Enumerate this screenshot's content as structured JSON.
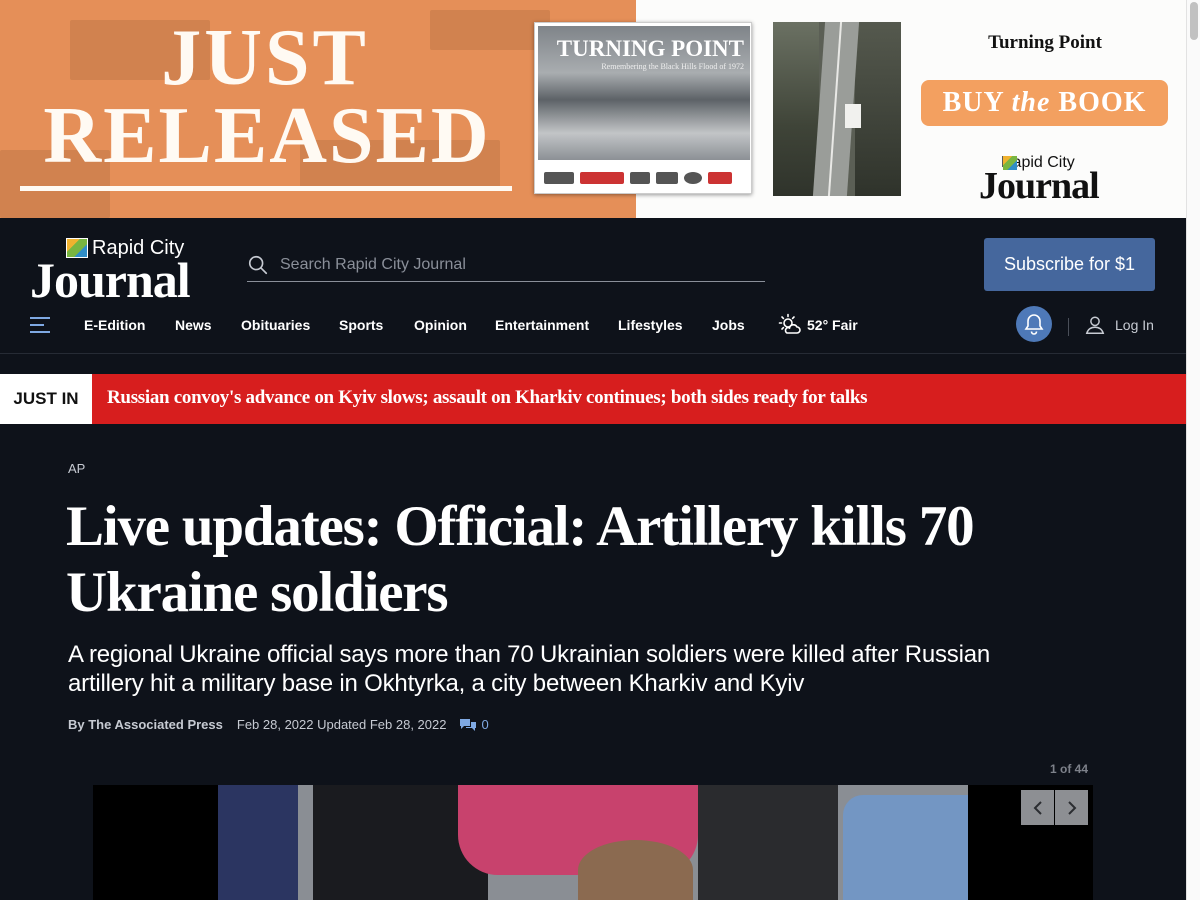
{
  "ad": {
    "headline_line1": "JUST",
    "headline_line2": "RELEASED",
    "book_title": "TURNING POINT",
    "book_subtitle": "Remembering the Black Hills Flood of 1972",
    "side_title": "Turning Point",
    "cta_pre": "BUY ",
    "cta_em": "the",
    "cta_post": " BOOK",
    "logo_small": "Rapid City",
    "logo_big": "Journal",
    "colors": {
      "orange": "#e58f58",
      "cta": "#f3a060"
    }
  },
  "header": {
    "logo_small": "Rapid City",
    "logo_big": "Journal",
    "search_placeholder": "Search Rapid City Journal",
    "subscribe_label": "Subscribe for $1",
    "colors": {
      "background": "#0e121a",
      "subscribe": "#45679d",
      "accent": "#7fa9e3"
    }
  },
  "nav": {
    "items": [
      "E-Edition",
      "News",
      "Obituaries",
      "Sports",
      "Opinion",
      "Entertainment",
      "Lifestyles",
      "Jobs"
    ],
    "weather": "52° Fair",
    "login": "Log In",
    "icons": {
      "menu": "hamburger-icon",
      "weather": "partly-sunny-icon",
      "bell": "bell-icon",
      "user": "user-icon"
    }
  },
  "just_in": {
    "label": "JUST IN",
    "headline": "Russian convoy's advance on Kyiv slows; assault on Kharkiv continues; both sides ready for talks",
    "colors": {
      "bar": "#d71e1e"
    }
  },
  "article": {
    "kicker": "AP",
    "headline": "Live updates: Official: Artillery kills 70 Ukraine soldiers",
    "dek": "A regional Ukraine official says more than 70 Ukrainian soldiers were killed after Russian artillery hit a military base in Okhtyrka, a city between Kharkiv and Kyiv",
    "byline": "By The Associated Press",
    "dates": "Feb 28, 2022 Updated Feb 28, 2022",
    "comment_count": "0",
    "gallery_counter": "1 of 44"
  }
}
